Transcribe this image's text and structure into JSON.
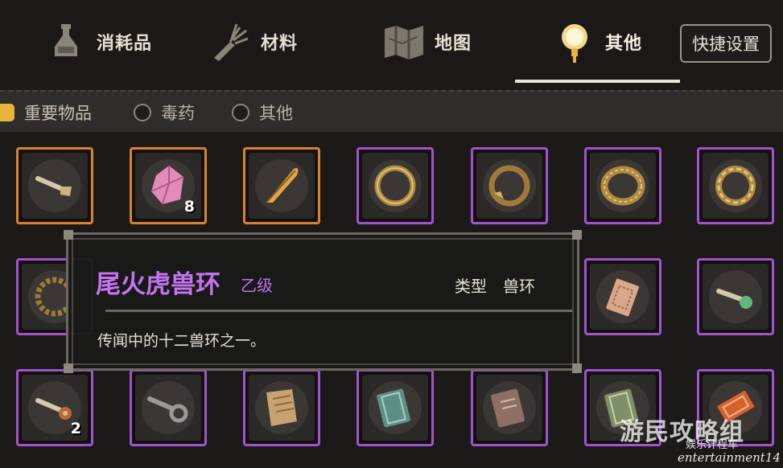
{
  "tabs": [
    {
      "label": "消耗品",
      "icon": "potion-icon",
      "active": false
    },
    {
      "label": "材料",
      "icon": "ginseng-root-icon",
      "active": false
    },
    {
      "label": "地图",
      "icon": "map-icon",
      "active": false
    },
    {
      "label": "其他",
      "icon": "lantern-icon",
      "active": true
    }
  ],
  "shortcut_button": "快捷设置",
  "filters": [
    {
      "label": "重要物品",
      "checked": true
    },
    {
      "label": "毒药",
      "checked": false
    },
    {
      "label": "其他",
      "checked": false
    }
  ],
  "items": {
    "row1": [
      {
        "icon": "key-icon",
        "rarity": "orange",
        "count": ""
      },
      {
        "icon": "pink-crystal-icon",
        "rarity": "orange",
        "count": "8"
      },
      {
        "icon": "feather-icon",
        "rarity": "orange",
        "count": ""
      },
      {
        "icon": "gold-ring-icon",
        "rarity": "purple",
        "count": ""
      },
      {
        "icon": "dragon-ring-icon",
        "rarity": "purple",
        "count": ""
      },
      {
        "icon": "braided-ring-icon",
        "rarity": "purple",
        "count": ""
      },
      {
        "icon": "twisted-ring-icon",
        "rarity": "purple",
        "count": ""
      }
    ],
    "row2_visible": [
      {
        "icon": "chain-ring-icon",
        "rarity": "purple"
      },
      {
        "icon": "ticket-icon",
        "rarity": "purple"
      },
      {
        "icon": "jade-key-icon",
        "rarity": "purple"
      }
    ],
    "row3": [
      {
        "icon": "ornate-key-icon",
        "rarity": "purple",
        "count": "2"
      },
      {
        "icon": "iron-key-icon",
        "rarity": "purple",
        "count": ""
      },
      {
        "icon": "scroll-icon",
        "rarity": "purple",
        "count": ""
      },
      {
        "icon": "teal-book-icon",
        "rarity": "purple",
        "count": ""
      },
      {
        "icon": "brown-book-icon",
        "rarity": "purple",
        "count": ""
      },
      {
        "icon": "green-book-icon",
        "rarity": "purple",
        "count": ""
      },
      {
        "icon": "red-ticket-icon",
        "rarity": "purple",
        "count": ""
      }
    ]
  },
  "tooltip": {
    "name": "尾火虎兽环",
    "grade": "乙级",
    "type_label": "类型",
    "type_value": "兽环",
    "description": "传闻中的十二兽环之一。"
  },
  "watermark": {
    "main": "游民攻略组",
    "sub": "娱乐计程车",
    "en": "entertainment14"
  },
  "colors": {
    "orange_rarity": "#d9832b",
    "purple_rarity": "#a452cf",
    "item_name": "#c474f0",
    "filter_checked": "#e9b43c"
  }
}
